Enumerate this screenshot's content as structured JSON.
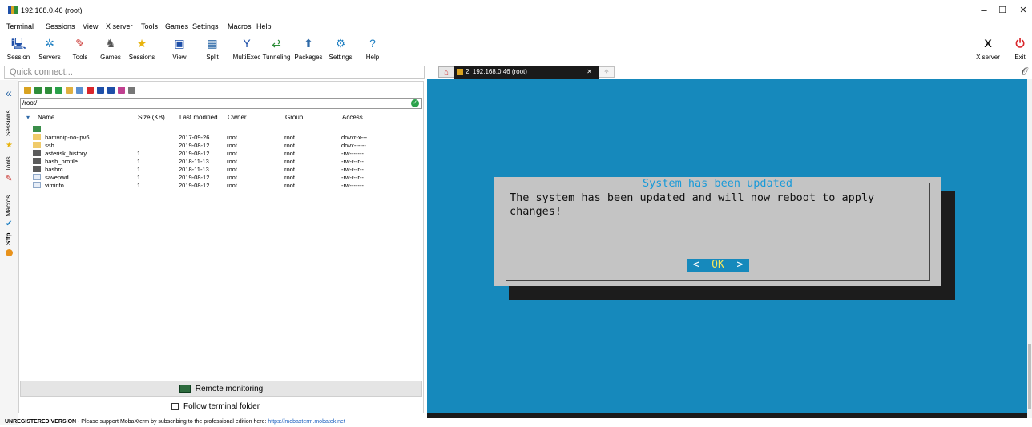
{
  "window": {
    "title": "192.168.0.46 (root)",
    "min": "–",
    "max": "☐",
    "close": "✕"
  },
  "menu": [
    "Terminal",
    "Sessions",
    "View",
    "X server",
    "Tools",
    "Games",
    "Settings",
    "Macros",
    "Help"
  ],
  "toolbar": [
    {
      "label": "Session",
      "icon": "session-icon",
      "glyph": "🖳",
      "color": "#1e4fa8"
    },
    {
      "label": "Servers",
      "icon": "servers-icon",
      "glyph": "✲",
      "color": "#1e7fc2"
    },
    {
      "label": "Tools",
      "icon": "tools-icon",
      "glyph": "✎",
      "color": "#c9302c"
    },
    {
      "label": "Games",
      "icon": "games-icon",
      "glyph": "♞",
      "color": "#555555"
    },
    {
      "label": "Sessions",
      "icon": "star-icon",
      "glyph": "★",
      "color": "#e8b30c"
    },
    {
      "label": "View",
      "icon": "view-icon",
      "glyph": "▣",
      "color": "#1e4fa8"
    },
    {
      "label": "Split",
      "icon": "split-icon",
      "glyph": "▦",
      "color": "#2f6aa8"
    },
    {
      "label": "MultiExec",
      "icon": "multiexec-icon",
      "glyph": "Y",
      "color": "#1e4fa8"
    },
    {
      "label": "Tunneling",
      "icon": "tunneling-icon",
      "glyph": "⇄",
      "color": "#2f8e3a"
    },
    {
      "label": "Packages",
      "icon": "packages-icon",
      "glyph": "⬆",
      "color": "#2f6aa8"
    },
    {
      "label": "Settings",
      "icon": "gear-icon",
      "glyph": "⚙",
      "color": "#1e7fc2"
    },
    {
      "label": "Help",
      "icon": "help-icon",
      "glyph": "?",
      "color": "#1e7fc2"
    }
  ],
  "toolbar_right": [
    {
      "label": "X server",
      "icon": "x-server-icon",
      "glyph": "X",
      "color": "#111111"
    },
    {
      "label": "Exit",
      "icon": "power-icon",
      "glyph": "⏻",
      "color": "#d9262b"
    }
  ],
  "quick_connect": {
    "placeholder": "Quick connect..."
  },
  "side_tabs": [
    "Sessions",
    "Tools",
    "Macros",
    "Sftp"
  ],
  "sftp": {
    "path": "/root/",
    "columns": [
      "Name",
      "Size (KB)",
      "Last modified",
      "Owner",
      "Group",
      "Access"
    ],
    "rows": [
      {
        "name": "..",
        "size": "",
        "modified": "",
        "owner": "",
        "group": "",
        "access": "",
        "type": "parent"
      },
      {
        "name": ".hamvoip-no-ipv6",
        "size": "",
        "modified": "2017-09-26 ...",
        "owner": "root",
        "group": "root",
        "access": "drwxr-x---",
        "type": "folder"
      },
      {
        "name": ".ssh",
        "size": "",
        "modified": "2019-08-12 ...",
        "owner": "root",
        "group": "root",
        "access": "drwx------",
        "type": "folder"
      },
      {
        "name": ".asterisk_history",
        "size": "1",
        "modified": "2019-08-12 ...",
        "owner": "root",
        "group": "root",
        "access": "-rw-------",
        "type": "file"
      },
      {
        "name": ".bash_profile",
        "size": "1",
        "modified": "2018-11-13 ...",
        "owner": "root",
        "group": "root",
        "access": "-rw-r--r--",
        "type": "file"
      },
      {
        "name": ".bashrc",
        "size": "1",
        "modified": "2018-11-13 ...",
        "owner": "root",
        "group": "root",
        "access": "-rw-r--r--",
        "type": "file"
      },
      {
        "name": ".savepwd",
        "size": "1",
        "modified": "2019-08-12 ...",
        "owner": "root",
        "group": "root",
        "access": "-rw-r--r--",
        "type": "doc"
      },
      {
        "name": ".viminfo",
        "size": "1",
        "modified": "2019-08-12 ...",
        "owner": "root",
        "group": "root",
        "access": "-rw-------",
        "type": "doc"
      }
    ],
    "remote_monitoring": "Remote monitoring",
    "follow_folder": "Follow terminal folder"
  },
  "tab": {
    "label": "2. 192.168.0.46 (root)",
    "close": "✕"
  },
  "dialog": {
    "title": "System has been updated",
    "message": "The system has been updated and will now reboot to apply changes!",
    "ok": "OK",
    "bracket_left": "<",
    "bracket_right": ">"
  },
  "status": {
    "bold": "UNREGISTERED VERSION",
    "text": "  -  Please support MobaXterm by subscribing to the professional edition here:  ",
    "link": "https://mobaxterm.mobatek.net"
  },
  "colors": {
    "terminal_bg": "#1689bc",
    "dialog_bg": "#c4c4c4",
    "dialog_title": "#1a9ad8",
    "ok_text": "#f3e65b"
  }
}
